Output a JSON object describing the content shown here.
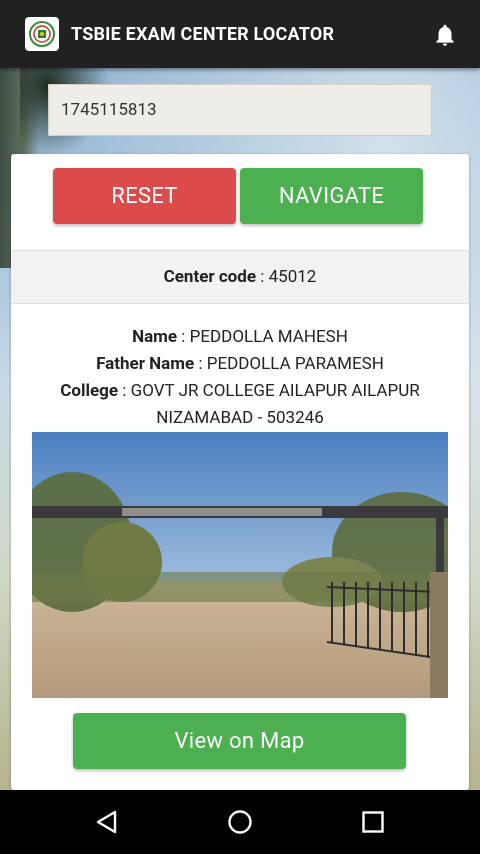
{
  "app": {
    "title": "TSBIE EXAM CENTER LOCATOR",
    "logo_icon": "tsbie-logo-icon",
    "notification_icon": "bell-icon"
  },
  "search": {
    "hall_ticket_value": "1745115813"
  },
  "actions": {
    "reset_label": "RESET",
    "navigate_label": "NAVIGATE",
    "view_map_label": "View on Map"
  },
  "center": {
    "code_label": "Center code",
    "code_value": "45012"
  },
  "student": {
    "name_label": "Name",
    "name_value": "PEDDOLLA MAHESH",
    "father_label": "Father Name",
    "father_value": "PEDDOLLA PARAMESH",
    "college_label": "College",
    "college_line1": "GOVT JR COLLEGE AILAPUR AILAPUR",
    "college_line2": "NIZAMABAD - 503246"
  },
  "colors": {
    "appbar": "#212121",
    "reset": "#dc4b4b",
    "navigate": "#4caf50"
  },
  "system_nav": {
    "back_icon": "back-triangle-icon",
    "home_icon": "home-circle-icon",
    "recents_icon": "recents-square-icon"
  }
}
